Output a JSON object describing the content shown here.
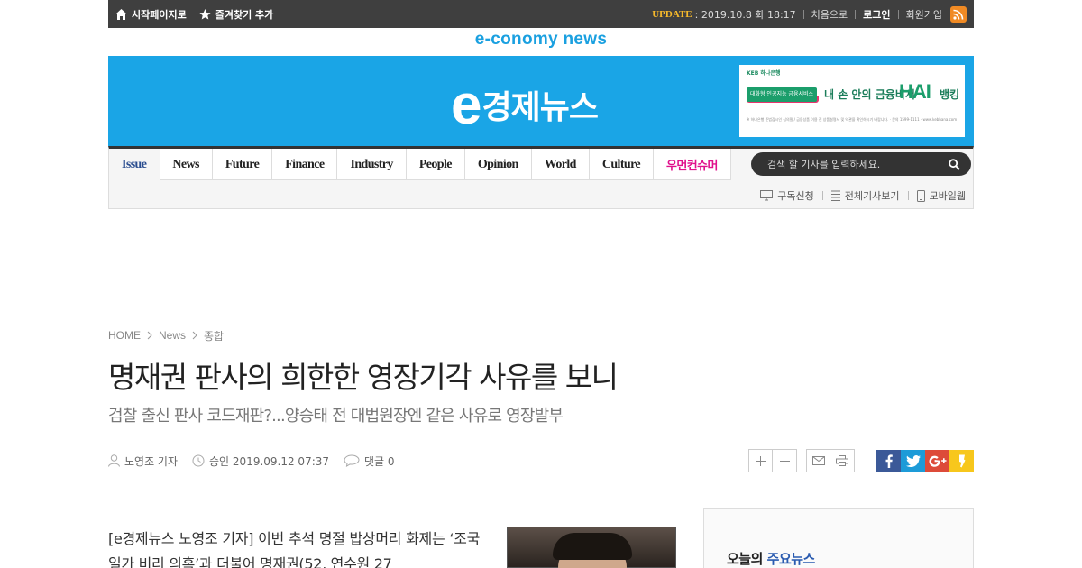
{
  "topbar": {
    "start_page": "시작페이지로",
    "bookmark": "즐겨찾기 추가",
    "update_label": "UPDATE",
    "update_date": ": 2019.10.8 화 18:17",
    "home": "처음으로",
    "login": "로그인",
    "signup": "회원가입"
  },
  "tagline": "e-conomy news",
  "logo": {
    "e": "e",
    "text": "경제뉴스"
  },
  "ad": {
    "bank": "KEB 하나은행",
    "pill": "대화형 인공지능 금융서비스",
    "headline": "내 손 안의 금융비서",
    "hai": "HAI",
    "banking": "뱅킹",
    "fine": "※ 하나은행 준법감시인 심의필 / 금융상품 이용 전 상품설명서 및 약관을 확인하시기 바랍니다. · 문의 1599-1111 · www.kebhana.com"
  },
  "menu": [
    "Issue",
    "News",
    "Future",
    "Finance",
    "Industry",
    "People",
    "Opinion",
    "World",
    "Culture",
    "우먼컨슈머"
  ],
  "search": {
    "placeholder": "검색 할 기사를 입력하세요."
  },
  "nav_sub": {
    "subscribe": "구독신청",
    "all_articles": "전체기사보기",
    "mobile": "모바일웹"
  },
  "breadcrumb": {
    "home": "HOME",
    "section": "News",
    "sub": "종합"
  },
  "article": {
    "title": "명재권 판사의 희한한 영장기각 사유를 보니",
    "subtitle": "검찰 출신 판사 코드재판?...양승태 전 대법원장엔 같은 사유로 영장발부",
    "author": "노영조 기자",
    "approved": "승인 2019.09.12 07:37",
    "comments": "댓글 0",
    "body": "[e경제뉴스 노영조 기자] 이번 추석 명절 밥상머리 화제는 ‘조국 일가 비리 의혹’과 더불어 명재권(52, 연수원 27"
  },
  "sidebar": {
    "title_prefix": "오늘의",
    "title_highlight": "주요뉴스"
  },
  "colors": {
    "header_blue": "#1aa5e6",
    "pink": "#e0108c",
    "update": "#f6b92b"
  }
}
